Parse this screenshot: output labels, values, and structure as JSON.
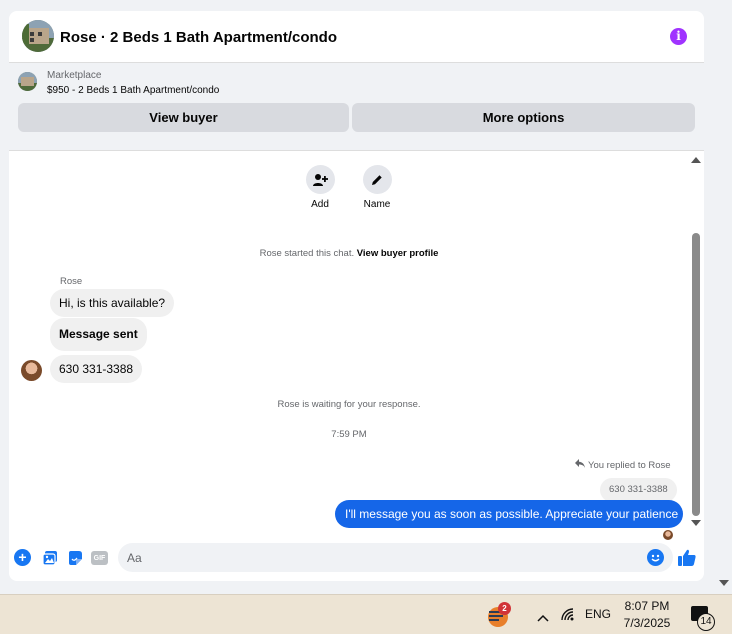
{
  "header": {
    "title": "Rose · 2 Beds 1 Bath Apartment/condo",
    "info_icon": "info-icon",
    "accent": "#a033ff"
  },
  "listing": {
    "kind": "Marketplace",
    "name": "$950 - 2 Beds 1 Bath Apartment/condo",
    "view_buyer": "View buyer",
    "more_options": "More options"
  },
  "actions": [
    {
      "label": "Add",
      "icon": "add-person-icon"
    },
    {
      "label": "Name",
      "icon": "pencil-icon"
    }
  ],
  "messages": {
    "started": "Rose started this chat.",
    "view_profile": "View buyer profile",
    "sender": "Rose",
    "incoming": [
      "Hi, is this available?",
      "Message sent",
      "630 331-3388"
    ],
    "waiting": "Rose is waiting for your response.",
    "time": "7:59 PM",
    "replied": "You replied to Rose",
    "quoted": "630 331-3388",
    "outgoing": "I'll message you as soon as possible. Appreciate your patience",
    "outgoing_color": "#1566e8"
  },
  "composer": {
    "placeholder": "Aa",
    "gif_label": "GIF"
  },
  "taskbar": {
    "app_badge": "2",
    "language": "ENG",
    "time": "8:07 PM",
    "date": "7/3/2025",
    "notifications": "14"
  }
}
